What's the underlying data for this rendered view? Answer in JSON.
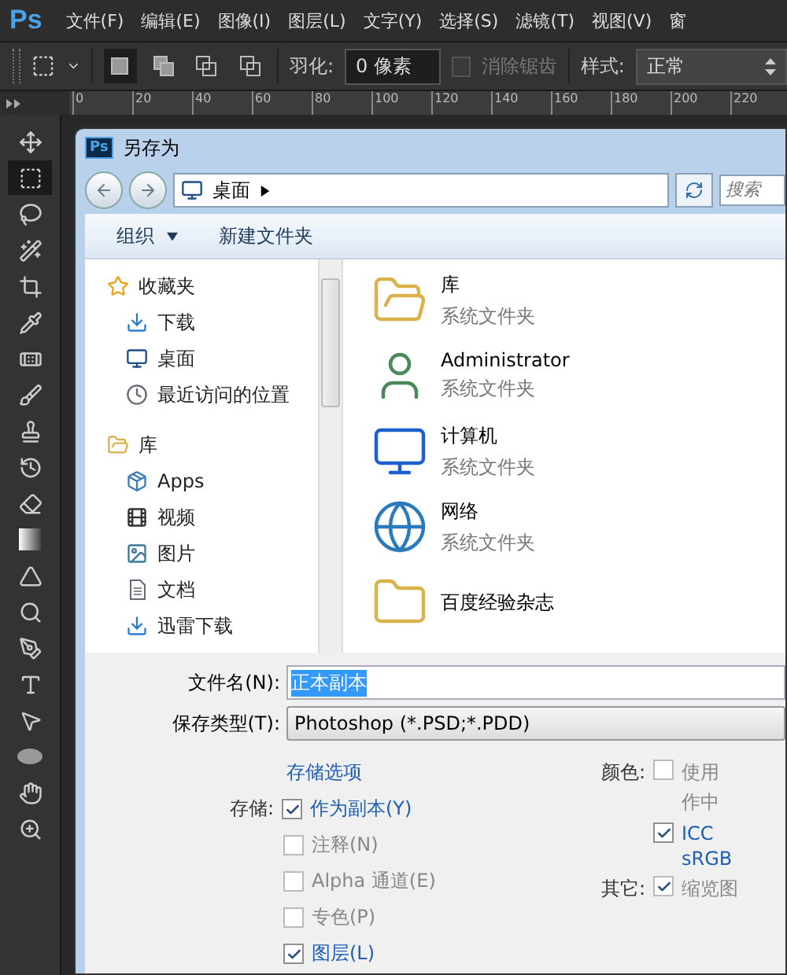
{
  "app": {
    "logo": "Ps",
    "menu": [
      "文件(F)",
      "编辑(E)",
      "图像(I)",
      "图层(L)",
      "文字(Y)",
      "选择(S)",
      "滤镜(T)",
      "视图(V)",
      "窗"
    ]
  },
  "options_bar": {
    "modes": [
      {
        "kind": "new",
        "selected": true
      },
      {
        "kind": "add",
        "selected": false
      },
      {
        "kind": "subtract",
        "selected": false
      },
      {
        "kind": "intersect",
        "selected": false
      }
    ],
    "feather_label": "羽化:",
    "feather_value": "0 像素",
    "antialias": {
      "label": "消除锯齿",
      "checked": false,
      "disabled": true
    },
    "style_label": "样式:",
    "style_value": "正常"
  },
  "ruler": [
    "0",
    "20",
    "40",
    "60",
    "80",
    "100",
    "120",
    "140",
    "160",
    "180",
    "200",
    "220"
  ],
  "tools": [
    {
      "kind": "move",
      "selected": false
    },
    {
      "kind": "marquee",
      "selected": true
    },
    {
      "kind": "lasso",
      "selected": false
    },
    {
      "kind": "wand",
      "selected": false
    },
    {
      "kind": "crop",
      "selected": false
    },
    {
      "kind": "eyedropper",
      "selected": false
    },
    {
      "kind": "bandage",
      "selected": false
    },
    {
      "kind": "brush",
      "selected": false
    },
    {
      "kind": "stamp",
      "selected": false
    },
    {
      "kind": "history",
      "selected": false
    },
    {
      "kind": "eraser",
      "selected": false
    },
    {
      "kind": "gradient",
      "selected": false
    },
    {
      "kind": "blur",
      "selected": false
    },
    {
      "kind": "dodge",
      "selected": false
    },
    {
      "kind": "pen",
      "selected": false
    },
    {
      "kind": "type",
      "selected": false
    },
    {
      "kind": "pointer",
      "selected": false
    },
    {
      "kind": "ellipse",
      "selected": false
    },
    {
      "kind": "hand",
      "selected": false
    },
    {
      "kind": "zoom",
      "selected": false
    }
  ],
  "dialog": {
    "app_icon": "Ps",
    "title": "另存为",
    "address": "桌面",
    "search_placeholder": "搜索",
    "toolbar": [
      "组织",
      "新建文件夹"
    ],
    "nav": [
      {
        "label": "收藏夹",
        "kind": "star",
        "children": [
          {
            "label": "下载",
            "kind": "download"
          },
          {
            "label": "桌面",
            "kind": "desktop"
          },
          {
            "label": "最近访问的位置",
            "kind": "recent"
          }
        ]
      },
      {
        "label": "库",
        "kind": "library",
        "children": [
          {
            "label": "Apps",
            "kind": "apps"
          },
          {
            "label": "视频",
            "kind": "video"
          },
          {
            "label": "图片",
            "kind": "picture"
          },
          {
            "label": "文档",
            "kind": "document"
          },
          {
            "label": "迅雷下载",
            "kind": "download"
          }
        ]
      }
    ],
    "files": [
      {
        "name": "库",
        "type": "系统文件夹",
        "kind": "library"
      },
      {
        "name": "Administrator",
        "type": "系统文件夹",
        "kind": "user"
      },
      {
        "name": "计算机",
        "type": "系统文件夹",
        "kind": "computer"
      },
      {
        "name": "网络",
        "type": "系统文件夹",
        "kind": "network"
      },
      {
        "name": "百度经验杂志",
        "kind": "folder"
      }
    ],
    "filename_label": "文件名(N):",
    "filename_value": "正本副本",
    "savetype_label": "保存类型(T):",
    "savetype_value": "Photoshop (*.PSD;*.PDD)",
    "options_link": "存储选项",
    "save_label": "存储:",
    "save_options": [
      {
        "label": "作为副本(Y)",
        "checked": true,
        "disabled": false
      },
      {
        "label": "注释(N)",
        "checked": false,
        "disabled": true
      },
      {
        "label": "Alpha 通道(E)",
        "checked": false,
        "disabled": true
      },
      {
        "label": "专色(P)",
        "checked": false,
        "disabled": true
      },
      {
        "label": "图层(L)",
        "checked": true,
        "disabled": false
      }
    ],
    "color_label": "颜色:",
    "color_options": [
      {
        "lines": [
          "使用",
          "作中"
        ],
        "checked": false,
        "disabled": true
      },
      {
        "lines": [
          "ICC",
          "sRGB"
        ],
        "checked": true,
        "disabled": false
      }
    ],
    "other_label": "其它:",
    "other_option": {
      "label": "缩览图",
      "checked": true,
      "disabled": true
    }
  }
}
